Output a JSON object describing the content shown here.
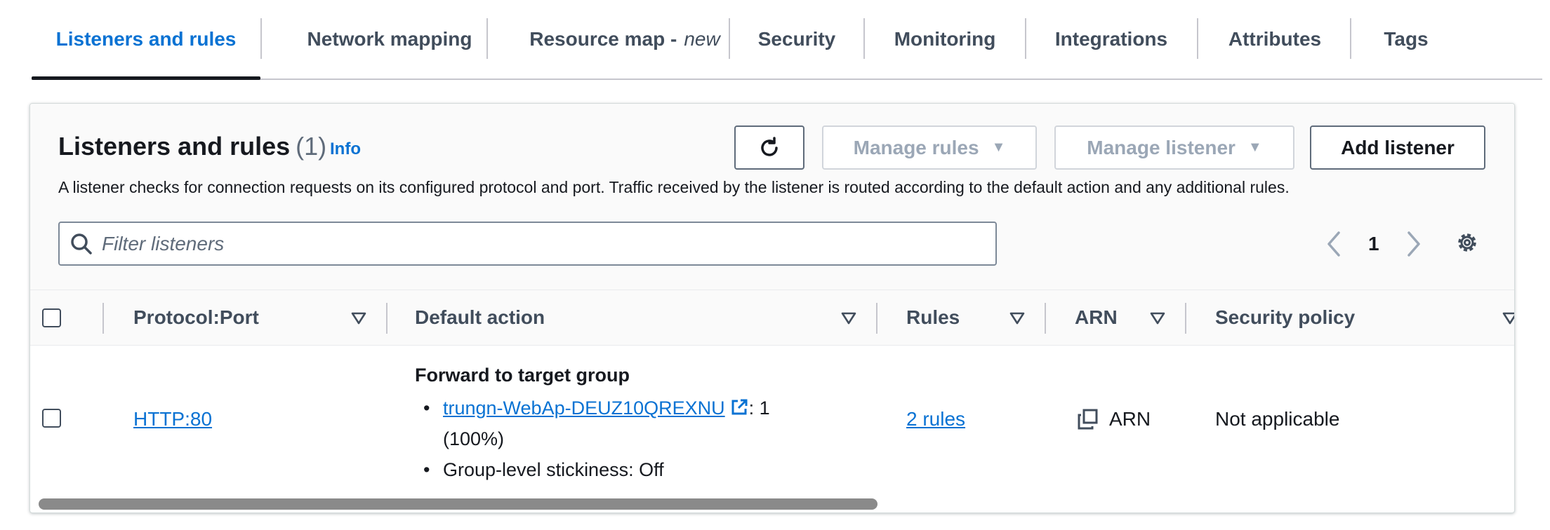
{
  "tabs": [
    {
      "label": "Listeners and rules",
      "active": true
    },
    {
      "label": "Network mapping"
    },
    {
      "label": "Resource map -",
      "badge": "new"
    },
    {
      "label": "Security"
    },
    {
      "label": "Monitoring"
    },
    {
      "label": "Integrations"
    },
    {
      "label": "Attributes"
    },
    {
      "label": "Tags"
    }
  ],
  "panel": {
    "title": "Listeners and rules",
    "count": "(1)",
    "info": "Info",
    "description": "A listener checks for connection requests on its configured protocol and port. Traffic received by the listener is routed according to the default action and any additional rules.",
    "buttons": {
      "manage_rules": "Manage rules",
      "manage_listener": "Manage listener",
      "add_listener": "Add listener"
    },
    "search": {
      "placeholder": "Filter listeners",
      "value": ""
    },
    "pagination": {
      "current_page": "1"
    }
  },
  "table": {
    "columns": [
      "Protocol:Port",
      "Default action",
      "Rules",
      "ARN",
      "Security policy"
    ],
    "rows": [
      {
        "protocol_port": "HTTP:80",
        "action_title": "Forward to target group",
        "target_group": "trungn-WebAp-DEUZ10QREXNU",
        "target_weight_a": ": 1",
        "target_weight_b": "(100%)",
        "stickiness": "Group-level stickiness: Off",
        "rules": "2 rules",
        "arn": "ARN",
        "security_policy": "Not applicable"
      }
    ]
  },
  "colors": {
    "accent": "#0972d3",
    "text": "#16191f",
    "muted": "#414d5c",
    "disabled": "#9ba7b6"
  }
}
